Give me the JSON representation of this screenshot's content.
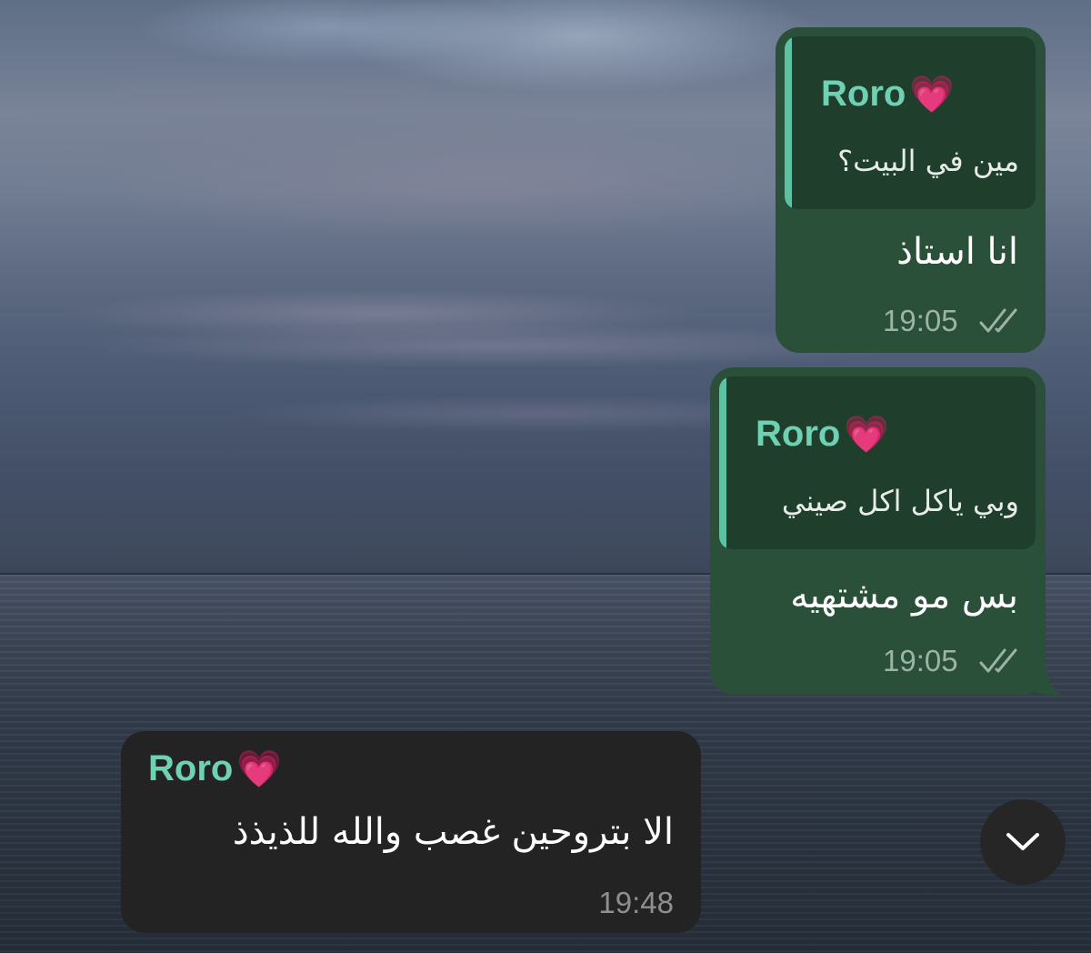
{
  "messages": [
    {
      "direction": "outgoing",
      "reply": {
        "sender": "Roro",
        "sender_emoji": "💗",
        "text": "مين في البيت؟"
      },
      "text": "انا استاذ",
      "time": "19:05",
      "status": "read",
      "status_icon": "double-check-icon"
    },
    {
      "direction": "outgoing",
      "reply": {
        "sender": "Roro",
        "sender_emoji": "💗",
        "text": "وبي ياكل اكل صيني"
      },
      "text": "بس مو مشتهيه",
      "time": "19:05",
      "status": "read",
      "status_icon": "double-check-icon"
    },
    {
      "direction": "incoming",
      "sender": "Roro",
      "sender_emoji": "💗",
      "text": "الا بتروحين غصب والله للذيذذ",
      "time": "19:48"
    }
  ],
  "scroll_down_button": {
    "icon": "chevron-down-icon"
  },
  "colors": {
    "outgoing_bubble": "#2a5039",
    "reply_quote": "#1f3f2c",
    "reply_accent": "#5cc2a4",
    "sender_name": "#6fd1b4",
    "incoming_bubble": "#232323"
  }
}
